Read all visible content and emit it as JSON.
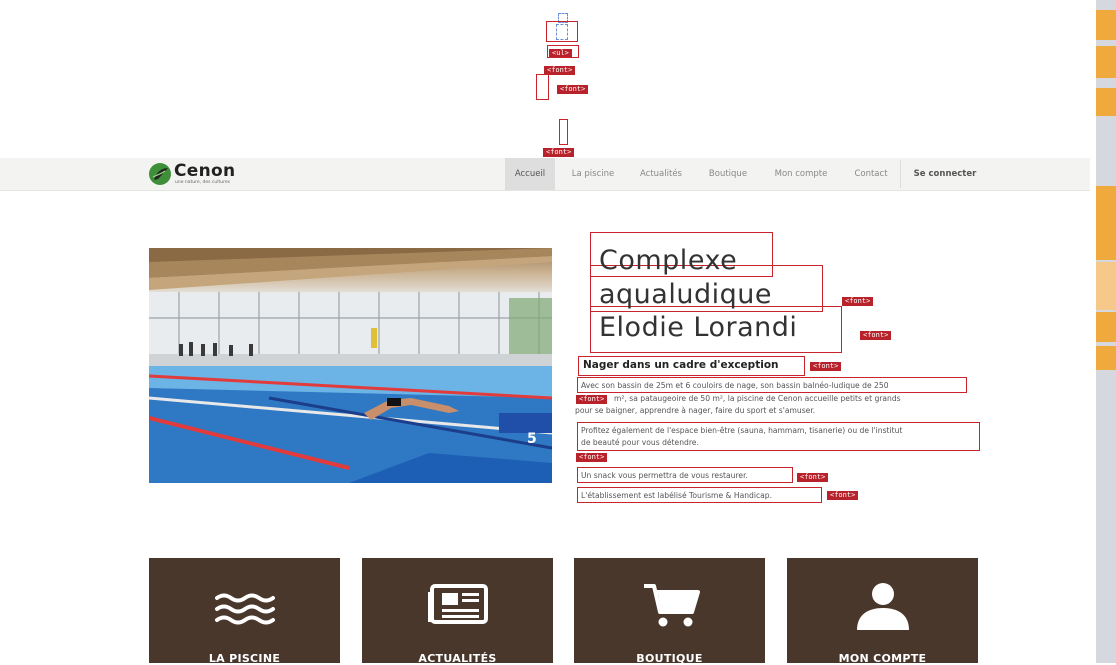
{
  "debug_tags": {
    "ul": "<ul>",
    "font": "<font>"
  },
  "brand": {
    "name": "Cenon",
    "tagline": "une nature, des cultures"
  },
  "nav": {
    "items": [
      "Accueil",
      "La piscine",
      "Actualités",
      "Boutique",
      "Mon compte",
      "Contact"
    ],
    "active": "Accueil",
    "login": "Se connecter"
  },
  "hero": {
    "title_lines": [
      "Complexe",
      "aqualudique",
      "Elodie Lorandi"
    ],
    "subtitle": "Nager dans un cadre d'exception",
    "paragraph1_lines": [
      "Avec son bassin de 25m et 6 couloirs de nage, son bassin balnéo-ludique de 250",
      "m², sa pataugeoire de 50 m², la piscine de Cenon accueille petits et grands",
      "pour se baigner, apprendre à nager, faire du sport et s'amuser."
    ],
    "paragraph2_lines": [
      "Profitez également de l'espace bien-être (sauna, hammam, tisanerie) ou de l'institut",
      "de beauté pour vous détendre."
    ],
    "paragraph3": "Un snack vous permettra de vous restaurer.",
    "paragraph4": "L'établissement est labélisé Tourisme & Handicap."
  },
  "cards": [
    {
      "label": "LA PISCINE",
      "icon": "waves-icon"
    },
    {
      "label": "ACTUALITÉS",
      "icon": "newspaper-icon"
    },
    {
      "label": "BOUTIQUE",
      "icon": "cart-icon"
    },
    {
      "label": "MON COMPTE",
      "icon": "user-icon"
    }
  ],
  "colors": {
    "accent_brown": "#4a372c",
    "debug_red": "#b8222a",
    "scroll_orange": "#f0a93c",
    "logo_green": "#3f8f3a"
  }
}
